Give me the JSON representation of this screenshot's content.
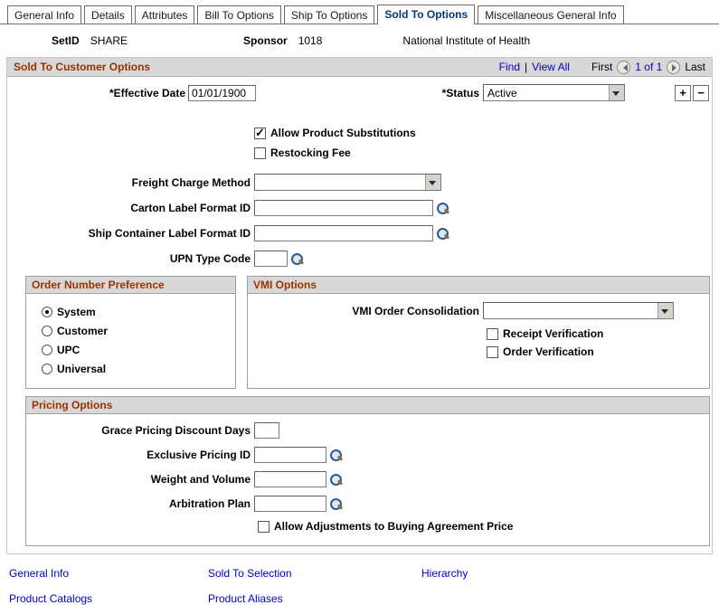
{
  "colors": {
    "group_title": "#993300",
    "link": "#0000cc",
    "active_tab_text": "#06357a"
  },
  "tabs": [
    {
      "label": "General Info"
    },
    {
      "label": "Details"
    },
    {
      "label": "Attributes"
    },
    {
      "label": "Bill To Options"
    },
    {
      "label": "Ship To Options"
    },
    {
      "label": "Sold To Options"
    },
    {
      "label": "Miscellaneous General Info"
    }
  ],
  "header": {
    "setid_label": "SetID",
    "setid_value": "SHARE",
    "sponsor_label": "Sponsor",
    "sponsor_id": "1018",
    "sponsor_name": "National Institute of Health"
  },
  "scroll_header": {
    "title": "Sold To Customer Options",
    "find": "Find",
    "separator": "|",
    "view_all": "View All",
    "first": "First",
    "page_indicator": "1 of 1",
    "last": "Last",
    "add_row": "+",
    "delete_row": "−"
  },
  "fields": {
    "effective_date": {
      "label": "*Effective Date",
      "value": "01/01/1900"
    },
    "status": {
      "label": "*Status",
      "value": "Active"
    },
    "allow_product_substitutions": {
      "label": "Allow Product Substitutions",
      "checked": true
    },
    "restocking_fee": {
      "label": "Restocking Fee",
      "checked": false
    },
    "freight_charge_method": {
      "label": "Freight Charge Method",
      "value": ""
    },
    "carton_label_format_id": {
      "label": "Carton Label Format ID",
      "value": ""
    },
    "ship_container_label_format_id": {
      "label": "Ship Container Label Format ID",
      "value": ""
    },
    "upn_type_code": {
      "label": "UPN Type Code",
      "value": ""
    }
  },
  "order_number_preference": {
    "title": "Order Number Preference",
    "options": [
      {
        "label": "System",
        "selected": true
      },
      {
        "label": "Customer",
        "selected": false
      },
      {
        "label": "UPC",
        "selected": false
      },
      {
        "label": "Universal",
        "selected": false
      }
    ]
  },
  "vmi_options": {
    "title": "VMI Options",
    "vmi_order_consolidation": {
      "label": "VMI Order Consolidation",
      "value": ""
    },
    "receipt_verification": {
      "label": "Receipt Verification",
      "checked": false
    },
    "order_verification": {
      "label": "Order Verification",
      "checked": false
    }
  },
  "pricing_options": {
    "title": "Pricing Options",
    "grace_pricing_discount_days": {
      "label": "Grace Pricing Discount Days",
      "value": ""
    },
    "exclusive_pricing_id": {
      "label": "Exclusive Pricing ID",
      "value": ""
    },
    "weight_and_volume": {
      "label": "Weight and Volume",
      "value": ""
    },
    "arbitration_plan": {
      "label": "Arbitration Plan",
      "value": ""
    },
    "allow_adjustments": {
      "label": "Allow Adjustments to Buying Agreement Price",
      "checked": false
    }
  },
  "related_links": [
    {
      "label": "General Info"
    },
    {
      "label": "Sold To Selection"
    },
    {
      "label": "Hierarchy"
    },
    {
      "label": "Product Catalogs"
    },
    {
      "label": "Product Aliases"
    }
  ]
}
